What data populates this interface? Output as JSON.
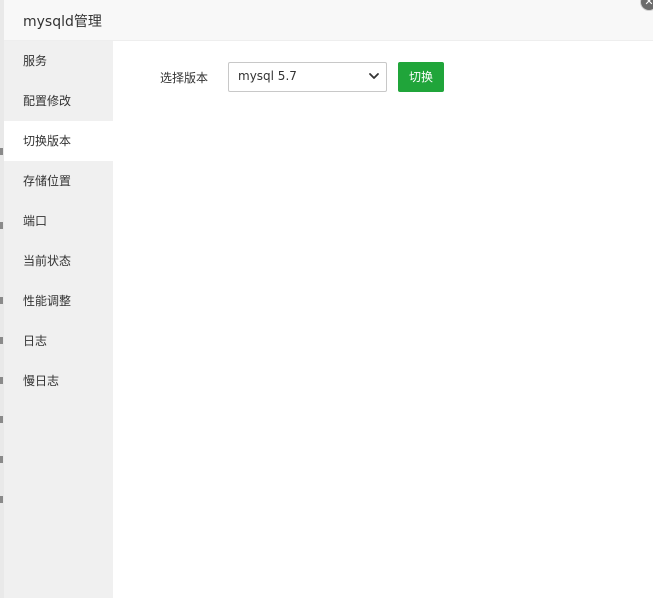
{
  "window": {
    "title": "mysqld管理",
    "close_icon": "close-icon"
  },
  "sidebar": {
    "items": [
      {
        "label": "服务"
      },
      {
        "label": "配置修改"
      },
      {
        "label": "切换版本"
      },
      {
        "label": "存储位置"
      },
      {
        "label": "端口"
      },
      {
        "label": "当前状态"
      },
      {
        "label": "性能调整"
      },
      {
        "label": "日志"
      },
      {
        "label": "慢日志"
      }
    ],
    "active_index": 2
  },
  "main": {
    "select_label": "选择版本",
    "version_select": {
      "value": "mysql 5.7",
      "icon": "chevron-down-icon"
    },
    "switch_button": "切换"
  },
  "colors": {
    "accent_green": "#20a53a",
    "sidebar_bg": "#f0f0f0",
    "title_bg": "#f8f8f8"
  }
}
